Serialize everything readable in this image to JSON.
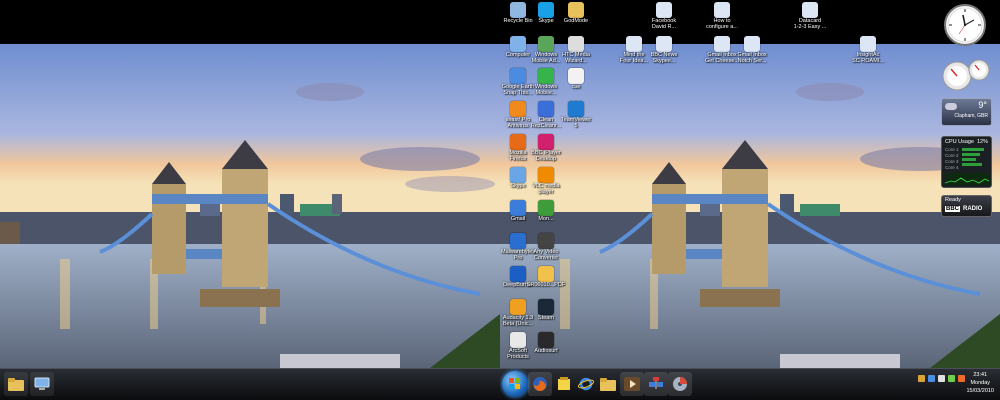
{
  "desktop_left": {
    "taskbar": {
      "items": [
        {
          "name": "folder-icon"
        },
        {
          "name": "computer-icon"
        }
      ]
    }
  },
  "desktop_right": {
    "icons": [
      {
        "id": "recycle",
        "label": "Recycle Bin",
        "icon": "recycle-bin-icon",
        "color": "#8fb7e0"
      },
      {
        "id": "skype",
        "label": "Skype",
        "icon": "skype-icon",
        "color": "#1aa0e6"
      },
      {
        "id": "godmode",
        "label": "GodMode",
        "icon": "folder-icon",
        "color": "#e9c15a"
      },
      {
        "id": "facebook",
        "label": "Facebook\nDavid R...",
        "icon": "shortcut-icon",
        "color": "#dce6f4"
      },
      {
        "id": "howto",
        "label": "How to\nconfigure a...",
        "icon": "shortcut-icon",
        "color": "#dce6f4"
      },
      {
        "id": "datacard",
        "label": "Datacard\n1-2-3 Easy ...",
        "icon": "shortcut-icon",
        "color": "#dce6f4"
      },
      {
        "id": "computer",
        "label": "Computer",
        "icon": "computer-icon",
        "color": "#7fb2e8"
      },
      {
        "id": "winmobile",
        "label": "Windows\nMobile Ad...",
        "icon": "mobile-icon",
        "color": "#5aa55a"
      },
      {
        "id": "htcmedia",
        "label": "HTC Media\nWizard...",
        "icon": "media-icon",
        "color": "#dddddd"
      },
      {
        "id": "mind",
        "label": "Mind the\nFour Idea...",
        "icon": "shortcut-icon",
        "color": "#dce6f4"
      },
      {
        "id": "bbcnews",
        "label": "BBC News\nSkypee...",
        "icon": "shortcut-icon",
        "color": "#dce6f4"
      },
      {
        "id": "gmail",
        "label": "Gmail Inbox\nGet Cheese...",
        "icon": "shortcut-icon",
        "color": "#dce6f4"
      },
      {
        "id": "gmail2",
        "label": "Gmail Inbox\nNotch Ser...",
        "icon": "shortcut-icon",
        "color": "#dce6f4"
      },
      {
        "id": "insight",
        "label": "InsightAc\nSC ROAMI...",
        "icon": "shortcut-icon",
        "color": "#dce6f4"
      },
      {
        "id": "google",
        "label": "Google Earth\nSnap This...",
        "icon": "globe-icon",
        "color": "#4b8be0"
      },
      {
        "id": "winmobile2",
        "label": "Windows\nMobile...",
        "icon": "mobile-icon",
        "color": "#36b34a"
      },
      {
        "id": "cue",
        "label": "cue",
        "icon": "document-icon",
        "color": "#f2f2f2"
      },
      {
        "id": "avast",
        "label": "avast! Pro\nAntivirus",
        "icon": "avast-icon",
        "color": "#f08a1c"
      },
      {
        "id": "cyberlink",
        "label": "Clean\nRezCleanr...",
        "icon": "app-icon",
        "color": "#3b6fd8"
      },
      {
        "id": "teamviewer",
        "label": "TeamViewer\n5",
        "icon": "teamviewer-icon",
        "color": "#1e7bd0"
      },
      {
        "id": "firefox",
        "label": "Mozilla\nFirefox",
        "icon": "firefox-icon",
        "color": "#e66a17"
      },
      {
        "id": "bbciplayer",
        "label": "BBC iPlayer\nDesktop",
        "icon": "iplayer-icon",
        "color": "#d1206e"
      },
      {
        "id": "skype2",
        "label": "Skype",
        "icon": "skype-icon",
        "color": "#6aa6e6"
      },
      {
        "id": "vlc",
        "label": "VLC media\nplayer",
        "icon": "vlc-icon",
        "color": "#f08a00"
      },
      {
        "id": "app1",
        "label": "Gmail",
        "icon": "app-icon",
        "color": "#3b7dd8"
      },
      {
        "id": "app2",
        "label": "Mon...",
        "icon": "app-icon",
        "color": "#3f9c3a"
      },
      {
        "id": "malware",
        "label": "Malwarebytes\nPro",
        "icon": "malware-icon",
        "color": "#2a6fd0"
      },
      {
        "id": "anyvideo",
        "label": "Any Video\nConverter",
        "icon": "video-icon",
        "color": "#444444"
      },
      {
        "id": "deepburner",
        "label": "DeepBurner",
        "icon": "deepburner-icon",
        "color": "#1b5fc4"
      },
      {
        "id": "doc",
        "label": "SR06010...PDF",
        "icon": "document-icon",
        "color": "#f2c14a"
      },
      {
        "id": "audacity",
        "label": "Audacity 1.3\nBeta (Unic...",
        "icon": "audacity-icon",
        "color": "#f0a020"
      },
      {
        "id": "steam",
        "label": "Steam",
        "icon": "steam-icon",
        "color": "#1b2838"
      },
      {
        "id": "arcsoft",
        "label": "ArcSoft\nProducts",
        "icon": "app-icon",
        "color": "#e8e8e8"
      },
      {
        "id": "audiosurf",
        "label": "Audiosurf",
        "icon": "audiosurf-icon",
        "color": "#2a2a2a"
      }
    ],
    "gadgets": {
      "weather": {
        "temp": "9°",
        "location": "Clapham, GBR"
      },
      "cpu": {
        "title": "CPU Usage",
        "value": "12%",
        "cores": [
          "Core 1",
          "Core 2",
          "Core 3",
          "Core 4"
        ]
      },
      "radio": {
        "status": "Ready",
        "brand": "BBC",
        "label": "RADIO"
      }
    },
    "taskbar": {
      "pinned": [
        {
          "name": "firefox-icon"
        },
        {
          "name": "notes-icon"
        },
        {
          "name": "internet-explorer-icon"
        },
        {
          "name": "explorer-folder-icon"
        },
        {
          "name": "media-player-icon"
        },
        {
          "name": "network-icon"
        },
        {
          "name": "disk-utility-icon"
        }
      ],
      "clock": {
        "time": "23:41",
        "day": "Monday",
        "date": "15/03/2010"
      }
    }
  }
}
